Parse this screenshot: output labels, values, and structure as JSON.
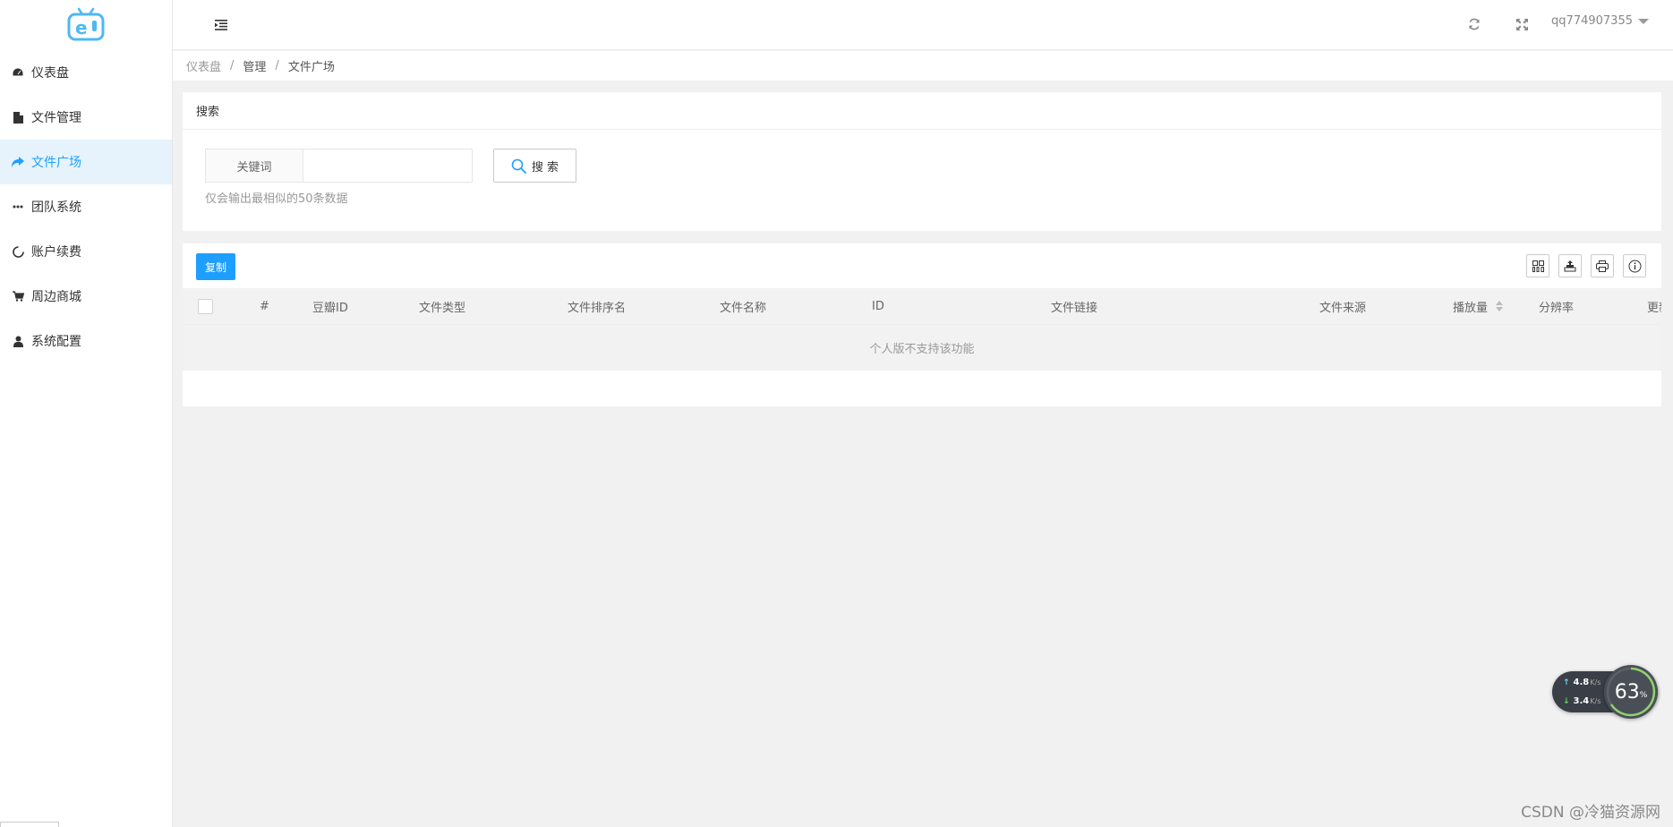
{
  "header": {
    "username": "qq774907355"
  },
  "sidebar": {
    "items": [
      {
        "label": "仪表盘",
        "icon": "dashboard-icon"
      },
      {
        "label": "文件管理",
        "icon": "file-icon"
      },
      {
        "label": "文件广场",
        "icon": "share-icon",
        "active": true
      },
      {
        "label": "团队系统",
        "icon": "more-icon"
      },
      {
        "label": "账户续费",
        "icon": "refresh-circle-icon"
      },
      {
        "label": "周边商城",
        "icon": "cart-icon"
      },
      {
        "label": "系统配置",
        "icon": "user-icon"
      }
    ]
  },
  "breadcrumb": [
    "仪表盘",
    "管理",
    "文件广场"
  ],
  "search": {
    "title": "搜索",
    "keyword_label": "关键词",
    "keyword_value": "",
    "button_label": "搜 索",
    "hint": "仅会输出最相似的50条数据"
  },
  "table": {
    "copy_label": "复制",
    "columns": [
      "#",
      "豆瓣ID",
      "文件类型",
      "文件排序名",
      "文件名称",
      "ID",
      "文件链接",
      "文件来源",
      "播放量",
      "分辨率",
      "更新"
    ],
    "empty_text": "个人版不支持该功能"
  },
  "netmon": {
    "upload": "4.8",
    "download": "3.4",
    "unit": "K/s",
    "percent": "63",
    "percent_sign": "%"
  },
  "watermark": "CSDN @冷猫资源网",
  "colors": {
    "accent": "#1e9fff",
    "active_bg": "#e6f3fc"
  }
}
